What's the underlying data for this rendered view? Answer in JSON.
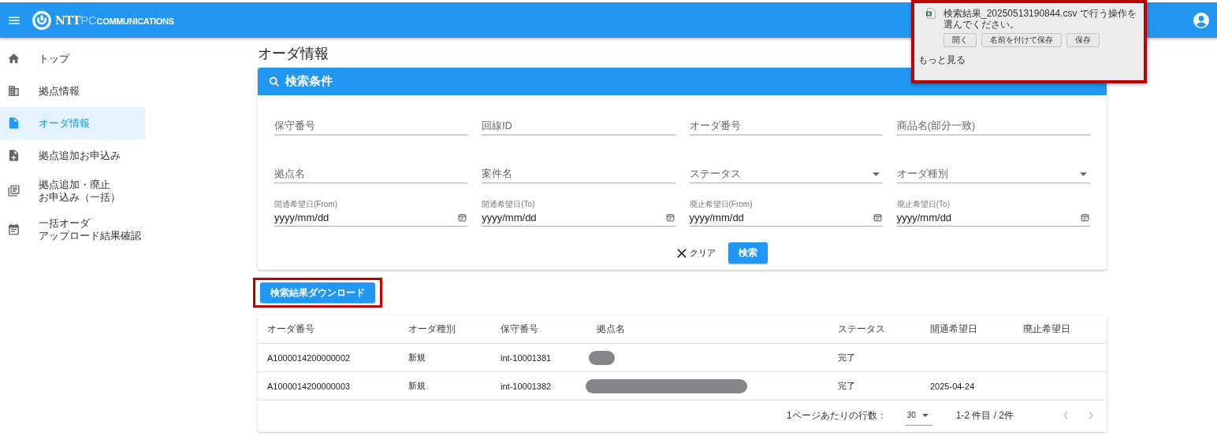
{
  "header": {
    "logo": {
      "mark": "NTT",
      "sub": "PC",
      "name": "COMMUNICATIONS"
    }
  },
  "sidebar": {
    "items": [
      {
        "lines": [
          "トップ"
        ],
        "selected": false
      },
      {
        "lines": [
          "拠点情報"
        ],
        "selected": false
      },
      {
        "lines": [
          "オーダ情報"
        ],
        "selected": true
      },
      {
        "lines": [
          "拠点追加お申込み"
        ],
        "selected": false
      },
      {
        "lines": [
          "拠点追加・廃止",
          "お申込み（一括）"
        ],
        "selected": false
      },
      {
        "lines": [
          "一括オーダ",
          "アップロード結果確認"
        ],
        "selected": false
      }
    ]
  },
  "page_title": "オーダ情報",
  "search": {
    "title": "検索条件",
    "fields": [
      {
        "kind": "text",
        "label": "保守番号"
      },
      {
        "kind": "text",
        "label": "回線ID"
      },
      {
        "kind": "text",
        "label": "オーダ番号"
      },
      {
        "kind": "text",
        "label": "商品名(部分一致)"
      },
      {
        "kind": "text",
        "label": "拠点名"
      },
      {
        "kind": "text",
        "label": "案件名"
      },
      {
        "kind": "select",
        "label": "ステータス"
      },
      {
        "kind": "select",
        "label": "オーダ種別"
      },
      {
        "kind": "date",
        "label": "開通希望日(From)",
        "value": "yyyy/mm/dd"
      },
      {
        "kind": "date",
        "label": "開通希望日(To)",
        "value": "yyyy/mm/dd"
      },
      {
        "kind": "date",
        "label": "廃止希望日(From)",
        "value": "yyyy/mm/dd"
      },
      {
        "kind": "date",
        "label": "廃止希望日(To)",
        "value": "yyyy/mm/dd"
      }
    ],
    "clear_button": "クリア",
    "search_button": "検索"
  },
  "download_button": {
    "label": "検索結果ダウンロード",
    "highlighted": true
  },
  "table": {
    "columns": [
      "オーダ番号",
      "オーダ種別",
      "保守番号",
      "拠点名",
      "ステータス",
      "開通希望日",
      "廃止希望日"
    ],
    "rows": [
      {
        "order_no": "A1000014200000002",
        "order_type": "新規",
        "maintenance_no": "int-10001381",
        "site": {
          "kind": "redacted"
        },
        "status": "完了"
      },
      {
        "order_no": "A1000014200000003",
        "order_type": "新規",
        "maintenance_no": "int-10001382",
        "site": {
          "kind": "redacted"
        },
        "status": "完了",
        "start_date": "2025-04-24"
      }
    ],
    "footer": {
      "rows_per_page_label": "1ページあたりの行数：",
      "rows_per_page": "30",
      "range": "1-2 件目 / 2件"
    }
  },
  "download_popup": {
    "highlighted": true,
    "message": "検索結果_20250513190844.csv で行う操作を選んでください。",
    "buttons": [
      "開く",
      "名前を付けて保存",
      "保存"
    ],
    "more": "もっと見る"
  }
}
